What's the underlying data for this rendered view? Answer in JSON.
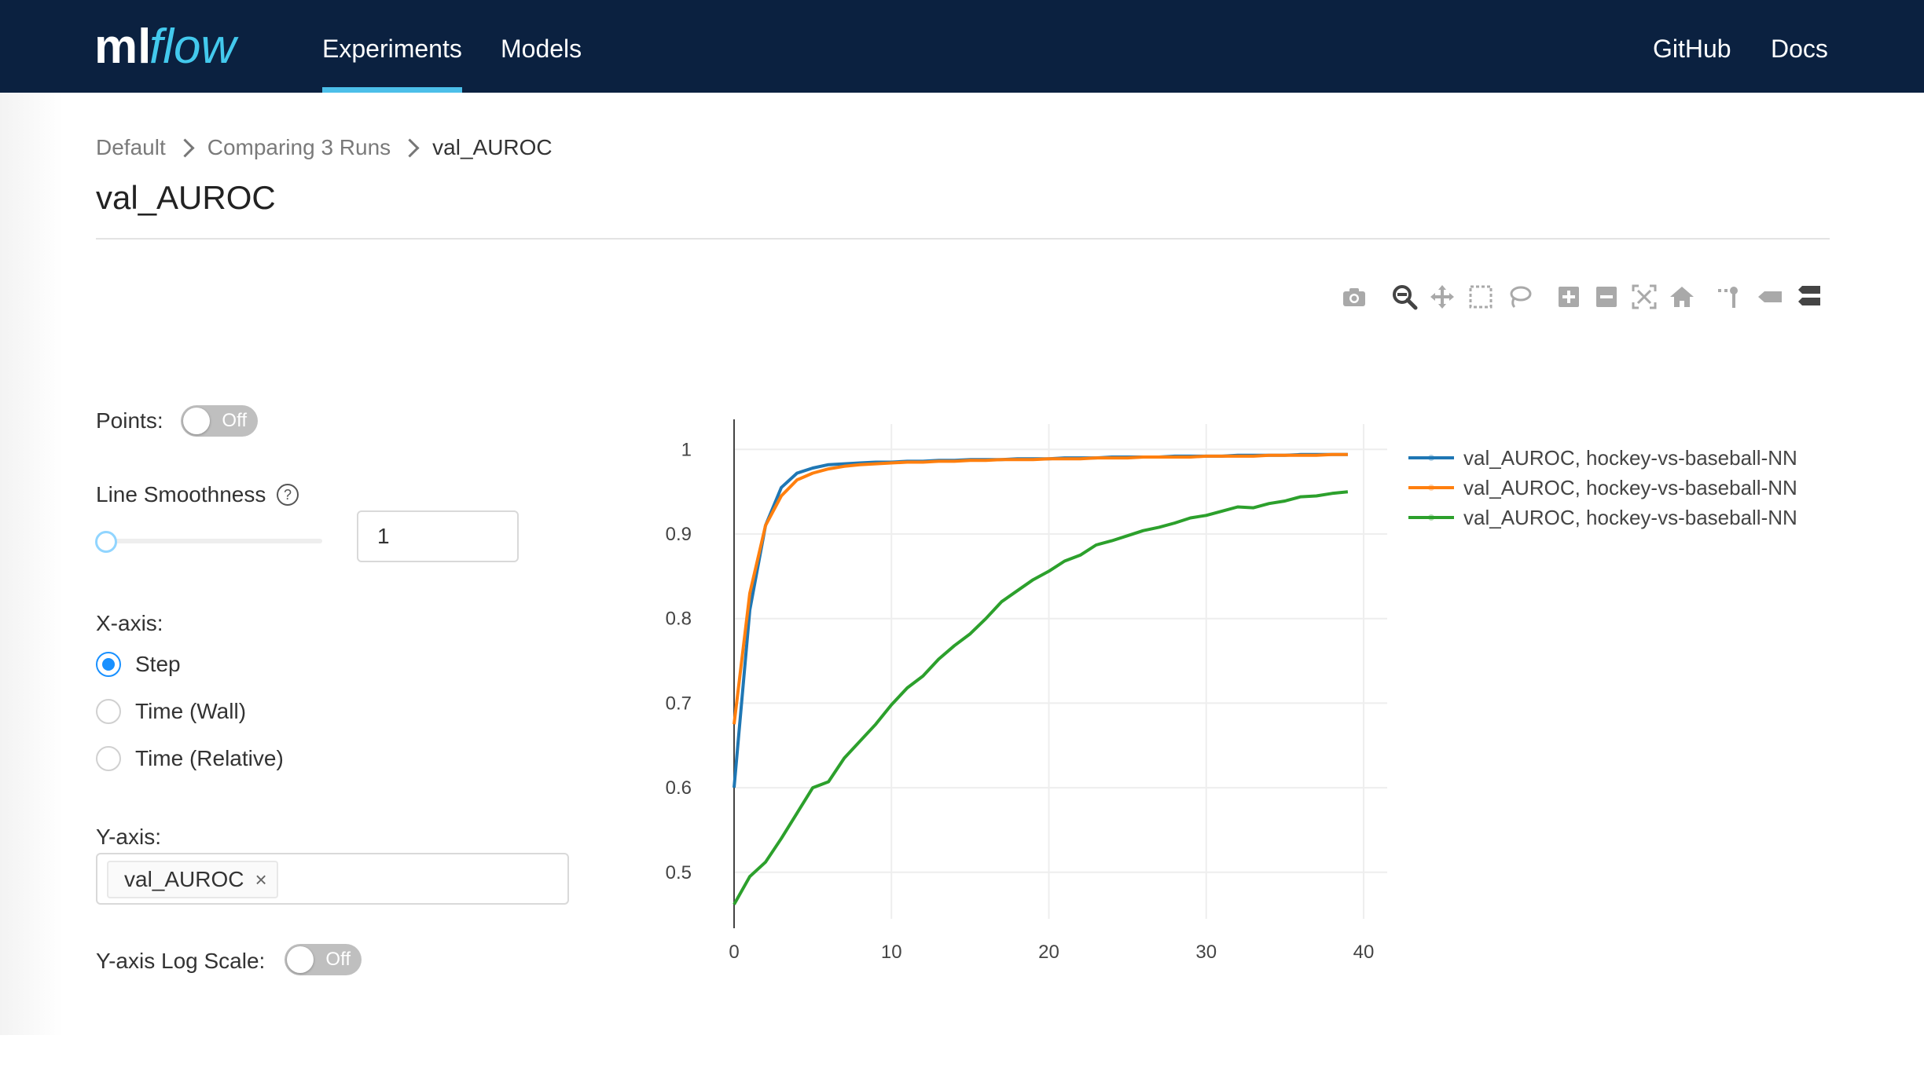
{
  "navbar": {
    "logo_text": "mlflow",
    "items": [
      {
        "label": "Experiments",
        "active": true
      },
      {
        "label": "Models",
        "active": false
      }
    ],
    "right_links": [
      {
        "label": "GitHub"
      },
      {
        "label": "Docs"
      }
    ],
    "colors": {
      "background": "#0b2140",
      "active_underline": "#4cbfe9"
    }
  },
  "breadcrumb": [
    {
      "label": "Default"
    },
    {
      "label": "Comparing 3 Runs"
    },
    {
      "label": "val_AUROC"
    }
  ],
  "page_title": "val_AUROC",
  "toolbar": {
    "icons": [
      "camera-icon",
      "zoom-icon",
      "pan-icon",
      "box-select-icon",
      "lasso-select-icon",
      "zoom-in-icon",
      "zoom-out-icon",
      "autoscale-icon",
      "reset-axes-icon",
      "spike-lines-icon",
      "hover-closest-icon",
      "hover-compare-icon"
    ]
  },
  "controls": {
    "points": {
      "label": "Points:",
      "state": "Off"
    },
    "line_smoothness": {
      "label": "Line Smoothness",
      "help_symbol": "?",
      "value": "1",
      "slider_fraction": 0
    },
    "x_axis": {
      "label": "X-axis:",
      "options": [
        {
          "label": "Step",
          "selected": true
        },
        {
          "label": "Time (Wall)",
          "selected": false
        },
        {
          "label": "Time (Relative)",
          "selected": false
        }
      ]
    },
    "y_axis": {
      "label": "Y-axis:",
      "selected_tags": [
        {
          "label": "val_AUROC",
          "close": "×"
        }
      ]
    },
    "y_log_scale": {
      "label": "Y-axis Log Scale:",
      "state": "Off"
    }
  },
  "chart_data": {
    "type": "line",
    "title": "",
    "xlabel": "",
    "ylabel": "",
    "xlim": [
      0,
      41.5
    ],
    "ylim": [
      0.445,
      1.03
    ],
    "xticks": [
      0,
      10,
      20,
      30,
      40
    ],
    "yticks": [
      0.5,
      0.6,
      0.7,
      0.8,
      0.9,
      1
    ],
    "grid": true,
    "legend_position": "right",
    "series": [
      {
        "name": "val_AUROC, hockey-vs-baseball-NN",
        "color": "#1f77b4",
        "x": [
          0,
          1,
          2,
          3,
          4,
          5,
          6,
          7,
          8,
          9,
          10,
          11,
          12,
          13,
          14,
          15,
          16,
          17,
          18,
          19,
          20,
          21,
          22,
          23,
          24,
          25,
          26,
          27,
          28,
          29,
          30,
          31,
          32,
          33,
          34,
          35,
          36,
          37,
          38,
          39
        ],
        "y": [
          0.6,
          0.81,
          0.91,
          0.955,
          0.972,
          0.978,
          0.982,
          0.983,
          0.984,
          0.985,
          0.985,
          0.986,
          0.986,
          0.987,
          0.987,
          0.988,
          0.988,
          0.988,
          0.989,
          0.989,
          0.989,
          0.99,
          0.99,
          0.99,
          0.991,
          0.991,
          0.991,
          0.991,
          0.992,
          0.992,
          0.992,
          0.992,
          0.993,
          0.993,
          0.993,
          0.993,
          0.994,
          0.994,
          0.994,
          0.994
        ]
      },
      {
        "name": "val_AUROC, hockey-vs-baseball-NN",
        "color": "#ff7f0e",
        "x": [
          0,
          1,
          2,
          3,
          4,
          5,
          6,
          7,
          8,
          9,
          10,
          11,
          12,
          13,
          14,
          15,
          16,
          17,
          18,
          19,
          20,
          21,
          22,
          23,
          24,
          25,
          26,
          27,
          28,
          29,
          30,
          31,
          32,
          33,
          34,
          35,
          36,
          37,
          38,
          39
        ],
        "y": [
          0.675,
          0.83,
          0.91,
          0.945,
          0.964,
          0.972,
          0.977,
          0.98,
          0.982,
          0.983,
          0.984,
          0.985,
          0.985,
          0.986,
          0.986,
          0.987,
          0.987,
          0.988,
          0.988,
          0.988,
          0.989,
          0.989,
          0.989,
          0.99,
          0.99,
          0.99,
          0.991,
          0.991,
          0.991,
          0.991,
          0.992,
          0.992,
          0.992,
          0.992,
          0.993,
          0.993,
          0.993,
          0.993,
          0.994,
          0.994
        ]
      },
      {
        "name": "val_AUROC, hockey-vs-baseball-NN",
        "color": "#2ca02c",
        "x": [
          0,
          1,
          2,
          3,
          4,
          5,
          6,
          7,
          8,
          9,
          10,
          11,
          12,
          13,
          14,
          15,
          16,
          17,
          18,
          19,
          20,
          21,
          22,
          23,
          24,
          25,
          26,
          27,
          28,
          29,
          30,
          31,
          32,
          33,
          34,
          35,
          36,
          37,
          38,
          39
        ],
        "y": [
          0.462,
          0.495,
          0.512,
          0.54,
          0.57,
          0.6,
          0.607,
          0.635,
          0.655,
          0.675,
          0.698,
          0.718,
          0.732,
          0.752,
          0.768,
          0.782,
          0.8,
          0.82,
          0.833,
          0.846,
          0.856,
          0.868,
          0.875,
          0.887,
          0.892,
          0.898,
          0.904,
          0.908,
          0.913,
          0.919,
          0.922,
          0.927,
          0.932,
          0.931,
          0.936,
          0.939,
          0.944,
          0.945,
          0.948,
          0.95
        ]
      }
    ]
  }
}
